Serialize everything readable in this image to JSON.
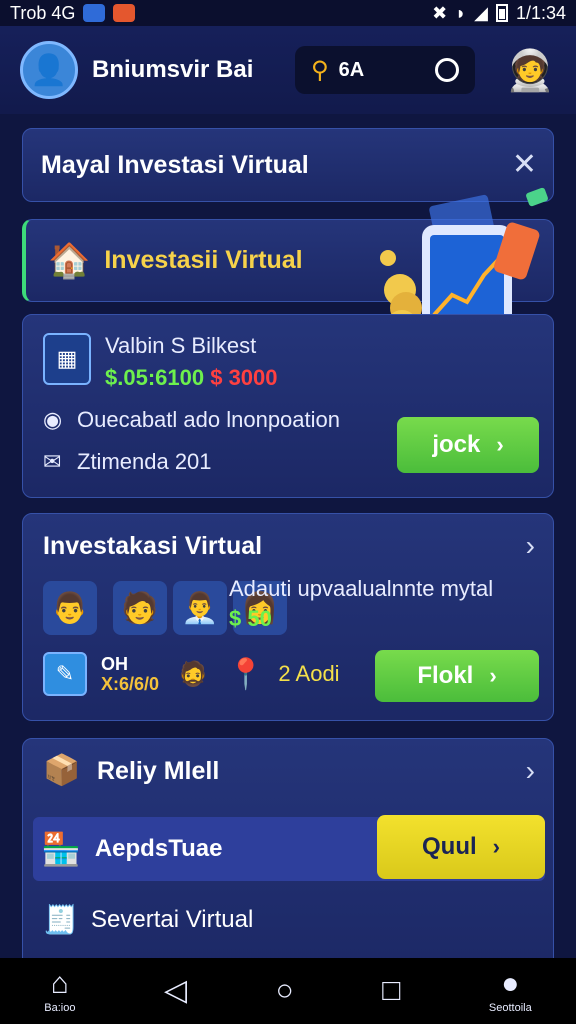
{
  "status_bar": {
    "carrier": "Trob 4G",
    "time": "1/1:34"
  },
  "header": {
    "username": "Bniumsvir Bai",
    "search_text": "6A"
  },
  "banner": {
    "title": "Mayal Investasi Virtual"
  },
  "section": {
    "label": "Investasii Virtual"
  },
  "info_card": {
    "wallet_title": "Valbin S Bilkest",
    "amount_green": "$.05:6100",
    "amount_red": "$ 3000",
    "line1": "Ouecabatl ado lnonpoation",
    "line2": "Ztimenda 201",
    "button_label": "jock"
  },
  "market_card": {
    "title": "Investakasi Virtual",
    "desc": "Adauti upvaalualnnte mytal",
    "price": "$ 50",
    "stat_label": "OH",
    "stat_value": "X:6/6/0",
    "rank": "2 Aodi",
    "button_label": "Flokl"
  },
  "lower_card": {
    "title": "Reliy Mlell",
    "strip_label": "AepdsTuae",
    "strip_button": "Quul",
    "row3_label": "Severtai Virtual"
  },
  "navbar": {
    "home_label": "Ba:ioo",
    "profile_label": "Seottoila"
  },
  "colors": {
    "background": "#0f1640",
    "accent_green": "#6df04d",
    "accent_yellow": "#f4e04a",
    "accent_red": "#ff4040"
  }
}
